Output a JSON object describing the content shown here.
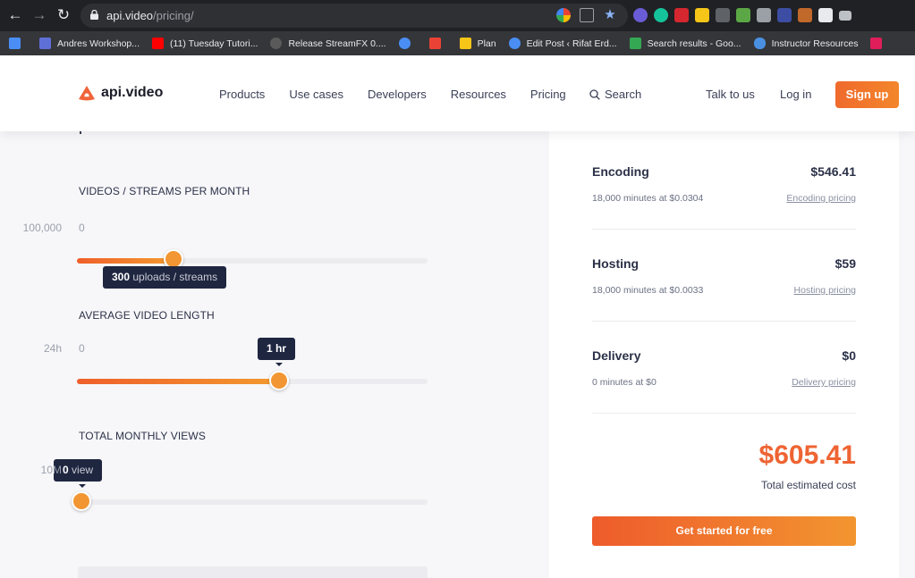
{
  "browser": {
    "url_host": "api.video",
    "url_path": "/pricing/",
    "bookmarks": [
      {
        "label": "Andres Workshop...",
        "color": "#5f6fd8"
      },
      {
        "label": "(11) Tuesday Tutori...",
        "color": "#ff0000"
      },
      {
        "label": "Release StreamFX 0....",
        "color": "#5a5a5a"
      },
      {
        "label": "",
        "color": "#4a8ef5"
      },
      {
        "label": "",
        "color": "#ea4335"
      },
      {
        "label": "Plan",
        "color": "#f5c518"
      },
      {
        "label": "Edit Post ‹ Rifat Erd...",
        "color": "#4a8ef5"
      },
      {
        "label": "Search results - Goo...",
        "color": "#34a853"
      },
      {
        "label": "Instructor Resources",
        "color": "#4a90e2"
      },
      {
        "label": "",
        "color": "#e01e5a"
      }
    ]
  },
  "header": {
    "logo": "api.video",
    "nav": [
      "Products",
      "Use cases",
      "Developers",
      "Resources",
      "Pricing"
    ],
    "search": "Search",
    "talk": "Talk to us",
    "login": "Log in",
    "signup": "Sign up"
  },
  "sliders": {
    "videos": {
      "label": "VIDEOS / STREAMS PER MONTH",
      "min": "0",
      "max": "100,000",
      "value_bold": "300",
      "value_rest": " uploads / streams"
    },
    "length": {
      "label": "AVERAGE VIDEO LENGTH",
      "min": "0",
      "max": "24h",
      "value_bold": "1 hr",
      "value_rest": ""
    },
    "views": {
      "label": "TOTAL MONTHLY VIEWS",
      "min": "0",
      "max": "10M",
      "value_bold": "0",
      "value_rest": " view"
    }
  },
  "costs": {
    "encoding": {
      "name": "Encoding",
      "value": "$546.41",
      "desc": "18,000 minutes at $0.0304",
      "link": "Encoding pricing"
    },
    "hosting": {
      "name": "Hosting",
      "value": "$59",
      "desc": "18,000 minutes at $0.0033",
      "link": "Hosting pricing"
    },
    "delivery": {
      "name": "Delivery",
      "value": "$0",
      "desc": "0 minutes at $0",
      "link": "Delivery pricing"
    },
    "total": "$605.41",
    "total_label": "Total estimated cost",
    "cta": "Get started for free"
  },
  "colors": {
    "accent": "#ee6433",
    "tooltip": "#1f2640"
  }
}
